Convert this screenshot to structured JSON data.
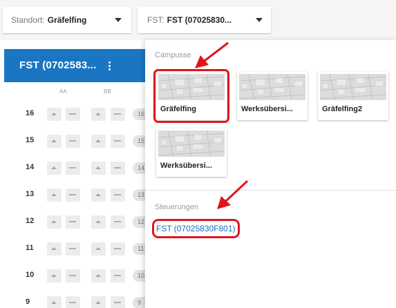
{
  "topbar": {
    "standort_label": "Standort:",
    "standort_value": "Gräfelfing",
    "fst_label": "FST:",
    "fst_value": "FST (07025830..."
  },
  "grid": {
    "header_title": "FST (0702583...",
    "columns": [
      "AA",
      "BB"
    ],
    "rows": [
      {
        "num": "16",
        "pill": "16"
      },
      {
        "num": "15",
        "pill": "15"
      },
      {
        "num": "14",
        "pill": "14"
      },
      {
        "num": "13",
        "pill": "13"
      },
      {
        "num": "12",
        "pill": "12"
      },
      {
        "num": "11",
        "pill": "11"
      },
      {
        "num": "10",
        "pill": "10"
      },
      {
        "num": "9",
        "pill": "9"
      }
    ]
  },
  "panel": {
    "campusse_title": "Campusse",
    "campuses": [
      {
        "name": "Gräfelfing",
        "selected": true
      },
      {
        "name": "Werksübersi...",
        "selected": false
      },
      {
        "name": "Gräfelfing2",
        "selected": false
      },
      {
        "name": "Werksübersi...",
        "selected": false
      }
    ],
    "steuerungen_title": "Steuerungen",
    "controls": [
      {
        "label": "FST (07025830F801)",
        "highlighted": true
      }
    ]
  },
  "colors": {
    "accent_blue": "#1a76c2",
    "link_blue": "#1a6fbe",
    "highlight_red": "#e0151c"
  },
  "icons": {
    "dropdown": "caret-down-icon",
    "menu": "kebab-menu-icon",
    "up": "arrow-up-icon",
    "down": "arrow-down-icon",
    "annotation": "red-arrow-icon"
  }
}
